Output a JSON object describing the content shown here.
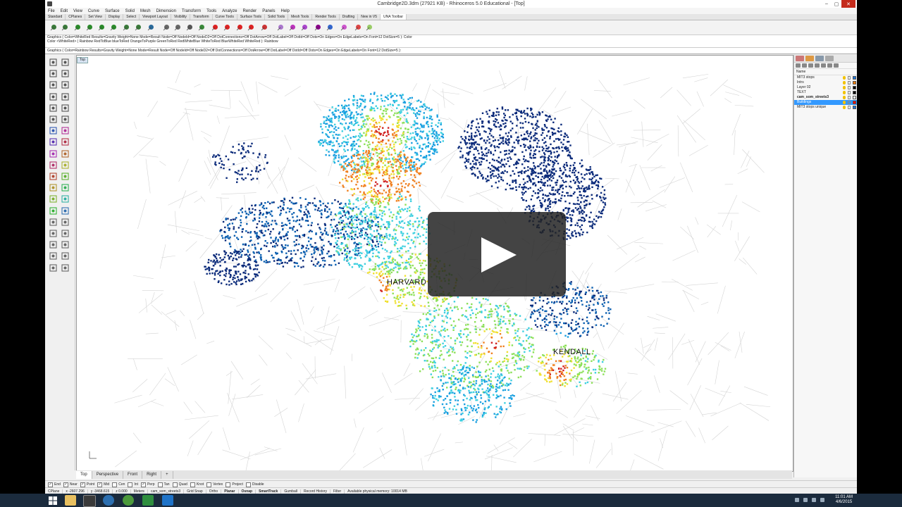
{
  "window": {
    "title": "Cambridge2D.3dm (27921 KB) - Rhinoceros 5.0 Educational - [Top]",
    "controls": [
      "–",
      "▢",
      "✕"
    ]
  },
  "menu": [
    "File",
    "Edit",
    "View",
    "Curve",
    "Surface",
    "Solid",
    "Mesh",
    "Dimension",
    "Transform",
    "Tools",
    "Analyze",
    "Render",
    "Panels",
    "Help"
  ],
  "toolbar_tabs": [
    "Standard",
    "CPlanes",
    "Set View",
    "Display",
    "Select",
    "Viewport Layout",
    "Visibility",
    "Transform",
    "Curve Tools",
    "Surface Tools",
    "Solid Tools",
    "Mesh Tools",
    "Render Tools",
    "Drafting",
    "New in V5",
    "UNA Toolbar"
  ],
  "active_toolbar_tab": "UNA Toolbar",
  "command_history": [
    "Graphics ( Color=WhiteRed  Results=Gravity  Weight=None  Mode=Result  Node=Off  NodeId=Off  NodeD2=Off  DotConnections=Off  DotArrow=Off  DotLabel=Off  DotId=Off  Dots=On  Edges=On  EdgeLabels=On  Font=12  DotSize=5 ): Color",
    "Color <WhiteRed> ( Rainbow  RedToBlue  blueToRed  OrangeToPurple  GreenToRed  RedWhiteBlue  WhiteToRed  BlueWhiteRed  WhiteRed ): Rainbow"
  ],
  "command_prompt": "Graphics ( Color=Rainbow  Results=Gravity  Weight=None  Mode=Result  Node=Off  NodeId=Off  NodeD2=Off  DotConnections=Off  DotArrow=Off  DotLabel=Off  DotId=Off  Dots=On  Edges=On  EdgeLabels=On  Font=12  DotSize=5 ):",
  "viewport": {
    "label": "Top",
    "map_labels": [
      "HARVARD",
      "KENDALL"
    ]
  },
  "layers_panel": {
    "header": "Name",
    "layers": [
      {
        "name": "MIT3 stops",
        "color": "#1a73d9",
        "selected": false,
        "bold": false
      },
      {
        "name": "Intrs",
        "color": "#ff7f00",
        "selected": false,
        "bold": false
      },
      {
        "name": "Layer 02",
        "color": "#000000",
        "selected": false,
        "bold": false
      },
      {
        "name": "TEXT",
        "color": "#000000",
        "selected": false,
        "bold": false
      },
      {
        "name": "cam_som_streets3",
        "color": "#ffffff",
        "selected": false,
        "bold": true
      },
      {
        "name": "Buildings",
        "color": "#ff0000",
        "selected": true,
        "bold": false
      },
      {
        "name": "MIT3 stops unique",
        "color": "#1a73d9",
        "selected": false,
        "bold": false
      }
    ]
  },
  "viewport_tabs": [
    "Top",
    "Perspective",
    "Front",
    "Right",
    "+"
  ],
  "active_viewport_tab": "Top",
  "osnaps": [
    {
      "label": "End",
      "checked": true
    },
    {
      "label": "Near",
      "checked": true
    },
    {
      "label": "Point",
      "checked": true
    },
    {
      "label": "Mid",
      "checked": true
    },
    {
      "label": "Cen",
      "checked": false
    },
    {
      "label": "Int",
      "checked": false
    },
    {
      "label": "Perp",
      "checked": true
    },
    {
      "label": "Tan",
      "checked": false
    },
    {
      "label": "Quad",
      "checked": false
    },
    {
      "label": "Knot",
      "checked": false
    },
    {
      "label": "Vertex",
      "checked": false
    },
    {
      "label": "Project",
      "checked": false
    },
    {
      "label": "Disable",
      "checked": false
    }
  ],
  "status": {
    "cplane": "CPlane",
    "x": "x -2607.296",
    "y": "y -3468.615",
    "z": "z 0.000",
    "units": "Meters",
    "layer": "cam_som_streets3",
    "toggles": [
      {
        "label": "Grid Snap",
        "on": false
      },
      {
        "label": "Ortho",
        "on": false
      },
      {
        "label": "Planar",
        "on": true
      },
      {
        "label": "Osnap",
        "on": true
      },
      {
        "label": "SmartTrack",
        "on": true
      },
      {
        "label": "Gumball",
        "on": false
      },
      {
        "label": "Record History",
        "on": false
      },
      {
        "label": "Filter",
        "on": false
      }
    ],
    "memory": "Available physical memory: 10014 MB"
  },
  "taskbar": {
    "time": "11:01 AM",
    "date": "4/6/2015"
  },
  "colors": {
    "selection": "#3399ff",
    "close_button": "#c42b1c",
    "taskbar": "#1b2b3d",
    "heatmap": [
      "#0a2a7a",
      "#0b5fb0",
      "#1aa0e0",
      "#3fd0e0",
      "#8de05a",
      "#f0e030",
      "#f08020",
      "#d02020"
    ]
  }
}
